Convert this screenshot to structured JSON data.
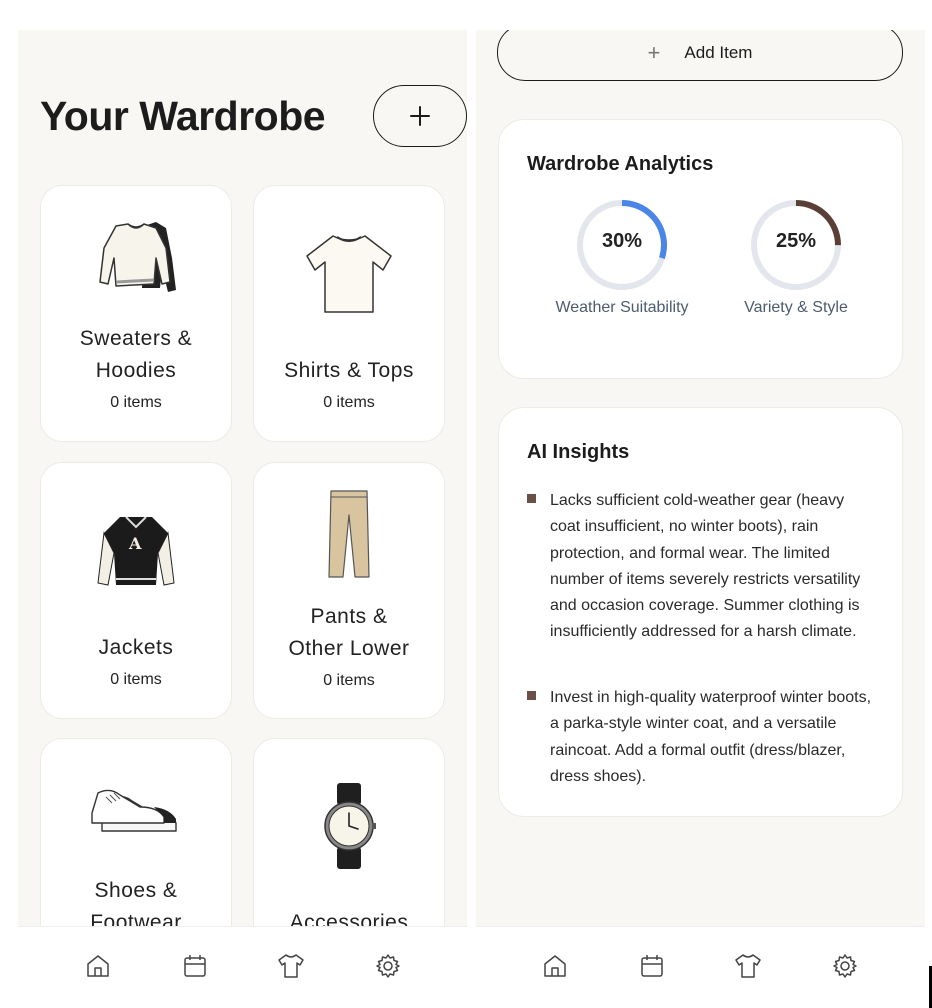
{
  "wardrobe": {
    "title": "Your Wardrobe",
    "add_button_icon": "plus-icon",
    "categories": [
      {
        "name_line1": "Sweaters &",
        "name_line2": "Hoodies",
        "count": "0 items",
        "icon": "sweater-icon"
      },
      {
        "name_line1": "Shirts & Tops",
        "name_line2": "",
        "count": "0 items",
        "icon": "tshirt-icon"
      },
      {
        "name_line1": "Jackets",
        "name_line2": "",
        "count": "0 items",
        "icon": "varsity-jacket-icon"
      },
      {
        "name_line1": "Pants &",
        "name_line2": "Other Lower",
        "count": "0 items",
        "icon": "pants-icon"
      },
      {
        "name_line1": "Shoes &",
        "name_line2": "Footwear",
        "count": "",
        "icon": "sneakers-icon"
      },
      {
        "name_line1": "Accessories",
        "name_line2": "",
        "count": "",
        "icon": "watch-icon"
      }
    ]
  },
  "right": {
    "add_item_label": "Add Item",
    "analytics": {
      "title": "Wardrobe Analytics",
      "gauges": [
        {
          "value": "30%",
          "percent": 30,
          "label": "Weather Suitability",
          "color": "#4a86e8"
        },
        {
          "value": "25%",
          "percent": 25,
          "label": "Variety & Style",
          "color": "#5a3f37"
        }
      ]
    },
    "insights": {
      "title": "AI Insights",
      "items": [
        "Lacks sufficient cold-weather gear (heavy coat insufficient, no winter boots), rain protection, and formal wear. The limited number of items severely restricts versatility and occasion coverage. Summer clothing is insufficiently addressed for a harsh climate.",
        "Invest in high-quality waterproof winter boots, a parka-style winter coat, and a versatile raincoat. Add a formal outfit (dress/blazer, dress shoes)."
      ],
      "bullet_color": "#6b5048"
    }
  },
  "tabbar": {
    "tabs": [
      {
        "icon": "home-icon"
      },
      {
        "icon": "calendar-icon"
      },
      {
        "icon": "tshirt-icon"
      },
      {
        "icon": "settings-gear-icon"
      }
    ]
  }
}
